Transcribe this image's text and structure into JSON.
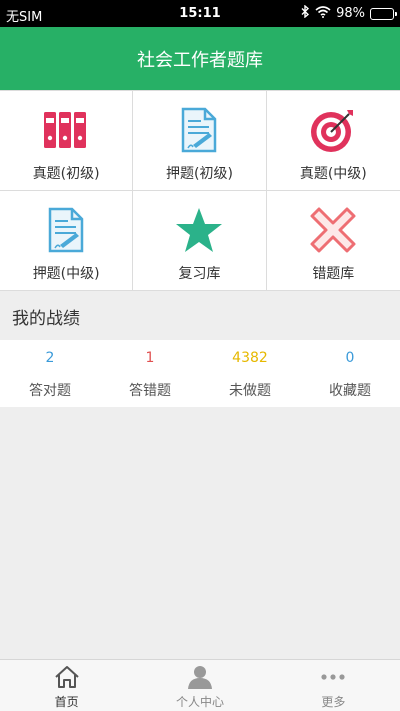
{
  "status_bar": {
    "carrier": "无SIM",
    "time": "15:11",
    "battery": "98%",
    "battery_level": 0.98
  },
  "header": {
    "title": "社会工作者题库"
  },
  "grid": [
    {
      "label": "真题(初级)",
      "icon": "binders-icon",
      "color": "#e0325c"
    },
    {
      "label": "押题(初级)",
      "icon": "document-pen-icon",
      "color": "#4aa9d8"
    },
    {
      "label": "真题(中级)",
      "icon": "target-icon",
      "color": "#e0325c"
    },
    {
      "label": "押题(中级)",
      "icon": "document-pen-icon",
      "color": "#4aa9d8"
    },
    {
      "label": "复习库",
      "icon": "star-icon",
      "color": "#2bb28a"
    },
    {
      "label": "错题库",
      "icon": "cross-icon",
      "color": "#ee6e73"
    }
  ],
  "my_stats": {
    "title": "我的战绩",
    "items": [
      {
        "value": "2",
        "label": "答对题",
        "color": "#3a9ad9"
      },
      {
        "value": "1",
        "label": "答错题",
        "color": "#e05050"
      },
      {
        "value": "4382",
        "label": "未做题",
        "color": "#e6b800"
      },
      {
        "value": "0",
        "label": "收藏题",
        "color": "#3a9ad9"
      }
    ]
  },
  "tabbar": {
    "items": [
      {
        "label": "首页",
        "icon": "home-icon"
      },
      {
        "label": "个人中心",
        "icon": "user-icon"
      },
      {
        "label": "更多",
        "icon": "more-icon"
      }
    ]
  }
}
